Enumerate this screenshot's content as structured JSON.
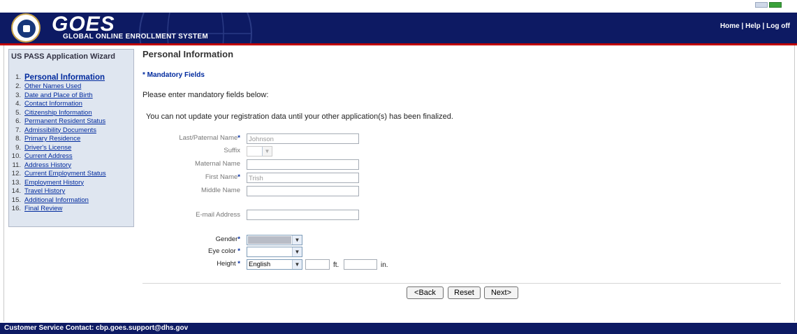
{
  "header": {
    "logo_text": "GOES",
    "tagline": "GLOBAL ONLINE ENROLLMENT SYSTEM",
    "links": [
      "Home",
      "Help",
      "Log off"
    ],
    "colors": {
      "banner": "#0d1a63",
      "accent_line": "#c00000"
    }
  },
  "sidebar": {
    "title": "US PASS Application Wizard",
    "items": [
      {
        "num": "1.",
        "label": "Personal Information",
        "active": true
      },
      {
        "num": "2.",
        "label": "Other Names Used"
      },
      {
        "num": "3.",
        "label": "Date and Place of Birth"
      },
      {
        "num": "4.",
        "label": "Contact Information"
      },
      {
        "num": "5.",
        "label": "Citizenship Information"
      },
      {
        "num": "6.",
        "label": "Permanent Resident Status"
      },
      {
        "num": "7.",
        "label": "Admissibility Documents"
      },
      {
        "num": "8.",
        "label": "Primary Residence"
      },
      {
        "num": "9.",
        "label": "Driver's License"
      },
      {
        "num": "10.",
        "label": "Current Address"
      },
      {
        "num": "11.",
        "label": "Address History"
      },
      {
        "num": "12.",
        "label": "Current Employment Status"
      },
      {
        "num": "13.",
        "label": "Employment History"
      },
      {
        "num": "14.",
        "label": "Travel History"
      },
      {
        "num": "15.",
        "label": "Additional Information"
      },
      {
        "num": "16.",
        "label": "Final Review"
      }
    ]
  },
  "main": {
    "title": "Personal Information",
    "mandatory_note": "* Mandatory Fields",
    "instructions": "Please enter mandatory fields below:",
    "notice": "You can not update your registration data until your other application(s) has been finalized.",
    "fields": {
      "last_name": {
        "label": "Last/Paternal Name",
        "value": "Johnson"
      },
      "suffix": {
        "label": "Suffix",
        "value": ""
      },
      "maternal_name": {
        "label": "Maternal Name",
        "value": ""
      },
      "first_name": {
        "label": "First Name",
        "value": "Trish"
      },
      "middle_name": {
        "label": "Middle Name",
        "value": ""
      },
      "email": {
        "label": "E-mail Address",
        "value": ""
      },
      "gender": {
        "label": "Gender",
        "value": ""
      },
      "eye_color": {
        "label": "Eye color",
        "value": ""
      },
      "height": {
        "label": "Height",
        "unit_system": "English",
        "feet": "",
        "inches": "",
        "ft_label": "ft.",
        "in_label": "in."
      }
    },
    "star": "*",
    "buttons": {
      "back": "<Back",
      "reset": "Reset",
      "next": "Next>"
    }
  },
  "footer": {
    "text": "Customer Service Contact: cbp.goes.support@dhs.gov"
  }
}
